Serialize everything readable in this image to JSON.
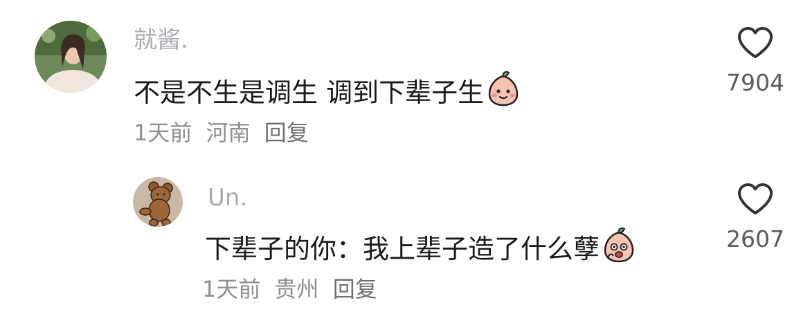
{
  "comments": [
    {
      "username": "就酱.",
      "text": "不是不生是调生 调到下辈子生",
      "emoji": "smiling-peach-emoji",
      "time": "1天前",
      "location": "河南",
      "reply_label": "回复",
      "likes": "7904"
    },
    {
      "username": "Un.",
      "text": "下辈子的你：我上辈子造了什么孽",
      "emoji": "crying-peach-emoji",
      "time": "1天前",
      "location": "贵州",
      "reply_label": "回复",
      "likes": "2607"
    }
  ],
  "colors": {
    "username": "#a9a9b0",
    "text": "#1a1a1a",
    "meta": "#8e8e93",
    "peach": "#f6c2b4",
    "leaf": "#4fae6a"
  }
}
